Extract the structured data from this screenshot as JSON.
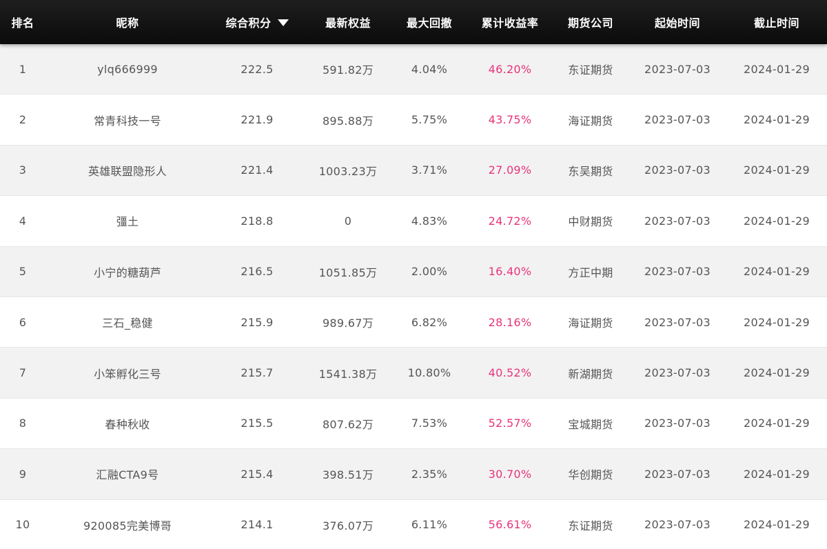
{
  "table": {
    "headers": {
      "rank": "排名",
      "nickname": "昵称",
      "score": "综合积分",
      "equity": "最新权益",
      "max_drawdown": "最大回撤",
      "cumulative_return": "累计收益率",
      "broker": "期货公司",
      "start_date": "起始时间",
      "end_date": "截止时间"
    },
    "sort": {
      "column": "score",
      "direction": "descending",
      "icon": "caret-down-icon"
    },
    "rows": [
      {
        "rank": "1",
        "nickname": "ylq666999",
        "score": "222.5",
        "equity": "591.82万",
        "max_drawdown": "4.04%",
        "cumulative_return": "46.20%",
        "broker": "东证期货",
        "start_date": "2023-07-03",
        "end_date": "2024-01-29"
      },
      {
        "rank": "2",
        "nickname": "常青科技一号",
        "score": "221.9",
        "equity": "895.88万",
        "max_drawdown": "5.75%",
        "cumulative_return": "43.75%",
        "broker": "海证期货",
        "start_date": "2023-07-03",
        "end_date": "2024-01-29"
      },
      {
        "rank": "3",
        "nickname": "英雄联盟隐形人",
        "score": "221.4",
        "equity": "1003.23万",
        "max_drawdown": "3.71%",
        "cumulative_return": "27.09%",
        "broker": "东吴期货",
        "start_date": "2023-07-03",
        "end_date": "2024-01-29"
      },
      {
        "rank": "4",
        "nickname": "彊土",
        "score": "218.8",
        "equity": "0",
        "max_drawdown": "4.83%",
        "cumulative_return": "24.72%",
        "broker": "中财期货",
        "start_date": "2023-07-03",
        "end_date": "2024-01-29"
      },
      {
        "rank": "5",
        "nickname": "小宁的糖葫芦",
        "score": "216.5",
        "equity": "1051.85万",
        "max_drawdown": "2.00%",
        "cumulative_return": "16.40%",
        "broker": "方正中期",
        "start_date": "2023-07-03",
        "end_date": "2024-01-29"
      },
      {
        "rank": "6",
        "nickname": "三石_稳健",
        "score": "215.9",
        "equity": "989.67万",
        "max_drawdown": "6.82%",
        "cumulative_return": "28.16%",
        "broker": "海证期货",
        "start_date": "2023-07-03",
        "end_date": "2024-01-29"
      },
      {
        "rank": "7",
        "nickname": "小笨孵化三号",
        "score": "215.7",
        "equity": "1541.38万",
        "max_drawdown": "10.80%",
        "cumulative_return": "40.52%",
        "broker": "新湖期货",
        "start_date": "2023-07-03",
        "end_date": "2024-01-29"
      },
      {
        "rank": "8",
        "nickname": "春种秋收",
        "score": "215.5",
        "equity": "807.62万",
        "max_drawdown": "7.53%",
        "cumulative_return": "52.57%",
        "broker": "宝城期货",
        "start_date": "2023-07-03",
        "end_date": "2024-01-29"
      },
      {
        "rank": "9",
        "nickname": "汇融CTA9号",
        "score": "215.4",
        "equity": "398.51万",
        "max_drawdown": "2.35%",
        "cumulative_return": "30.70%",
        "broker": "华创期货",
        "start_date": "2023-07-03",
        "end_date": "2024-01-29"
      },
      {
        "rank": "10",
        "nickname": "920085完美博哥",
        "score": "214.1",
        "equity": "376.07万",
        "max_drawdown": "6.11%",
        "cumulative_return": "56.61%",
        "broker": "东证期货",
        "start_date": "2023-07-03",
        "end_date": "2024-01-29"
      }
    ]
  },
  "colors": {
    "header_bg": "#111111",
    "header_text": "#ffffff",
    "row_odd_bg": "#f2f2f2",
    "row_even_bg": "#ffffff",
    "cell_text": "#555555",
    "return_text": "#e8337a"
  }
}
